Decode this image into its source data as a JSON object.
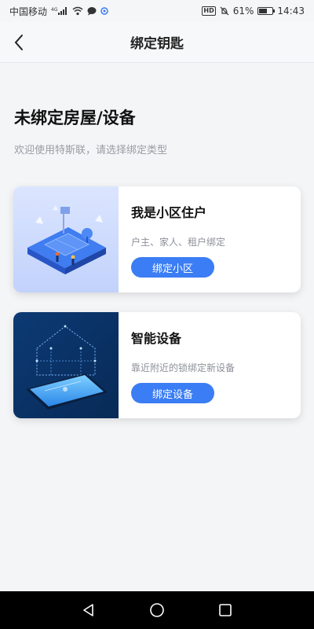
{
  "status_bar": {
    "carrier": "中国移动",
    "network": "4G",
    "hd": "HD",
    "battery": "61%",
    "battery_level": 0.61,
    "time": "14:43"
  },
  "nav": {
    "title": "绑定钥匙"
  },
  "page": {
    "heading": "未绑定房屋/设备",
    "subtitle": "欢迎使用特斯联，请选择绑定类型"
  },
  "cards": [
    {
      "title": "我是小区住户",
      "description": "户主、家人、租户绑定",
      "button_label": "绑定小区"
    },
    {
      "title": "智能设备",
      "description": "靠近附近的锁绑定新设备",
      "button_label": "绑定设备"
    }
  ],
  "colors": {
    "accent": "#3b7df4",
    "page_bg": "#f4f5f7",
    "card1_image_bg": "#c9d8ff",
    "card2_image_bg": "#0f3f7a"
  },
  "icons": {
    "back": "chevron-left-icon",
    "nav_back": "triangle-back-icon",
    "nav_home": "circle-home-icon",
    "nav_recent": "square-recent-icon"
  }
}
